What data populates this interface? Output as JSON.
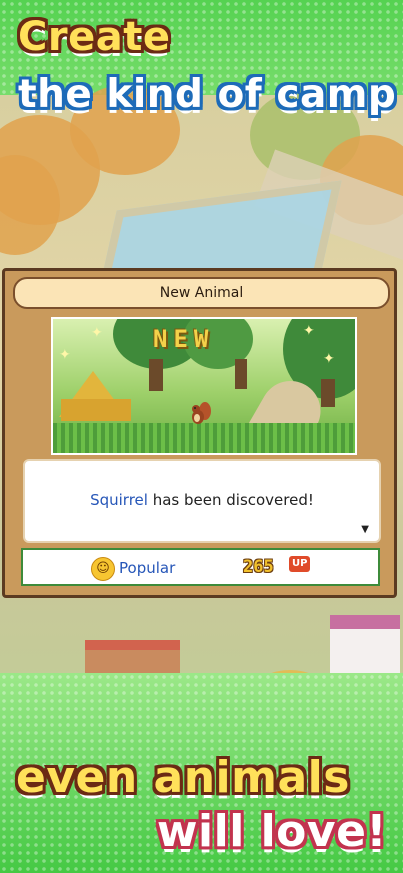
{
  "headline": {
    "line1": "Create",
    "line2": "the kind of camp",
    "line3": "even animals",
    "line4": "will love!"
  },
  "dialog": {
    "title": "New Animal",
    "badge": "NEW",
    "message": {
      "animal": "Squirrel",
      "rest": " has been discovered!"
    },
    "stat": {
      "label": "Popular",
      "value": "265",
      "up_label": "UP"
    }
  },
  "colors": {
    "dialog_frame": "#c99a5c",
    "title_bar": "#fbe4b6",
    "link_blue": "#2656b8",
    "stat_border": "#3d8b3a",
    "background_green": "#6fd86a"
  },
  "icons": [
    "popular-face-icon",
    "up-arrow-icon",
    "more-arrow-icon",
    "squirrel-icon",
    "tent-icon"
  ]
}
